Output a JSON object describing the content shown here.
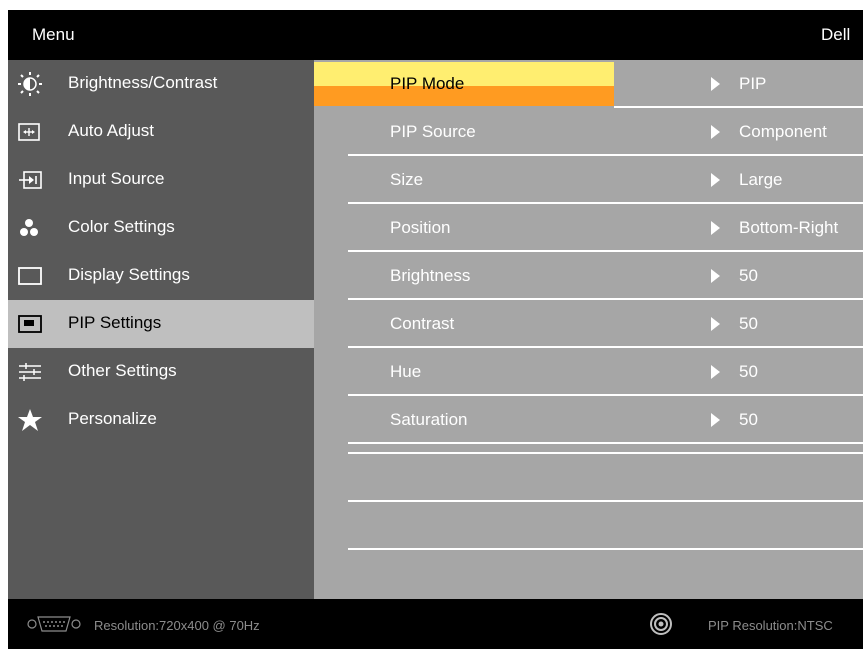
{
  "header": {
    "title": "Menu",
    "brand": "Dell"
  },
  "nav": {
    "items": [
      {
        "label": "Brightness/Contrast",
        "icon": "brightness-icon"
      },
      {
        "label": "Auto Adjust",
        "icon": "auto-adjust-icon"
      },
      {
        "label": "Input Source",
        "icon": "input-source-icon"
      },
      {
        "label": "Color Settings",
        "icon": "color-settings-icon"
      },
      {
        "label": "Display Settings",
        "icon": "display-settings-icon"
      },
      {
        "label": "PIP Settings",
        "icon": "pip-icon"
      },
      {
        "label": "Other Settings",
        "icon": "other-settings-icon"
      },
      {
        "label": "Personalize",
        "icon": "star-icon"
      }
    ],
    "selected": "PIP Settings"
  },
  "settings": {
    "rows": [
      {
        "name": "PIP Mode",
        "value": "PIP"
      },
      {
        "name": "PIP Source",
        "value": "Component"
      },
      {
        "name": "Size",
        "value": "Large"
      },
      {
        "name": "Position",
        "value": "Bottom-Right"
      },
      {
        "name": "Brightness",
        "value": "50"
      },
      {
        "name": "Contrast",
        "value": "50"
      },
      {
        "name": "Hue",
        "value": "50"
      },
      {
        "name": "Saturation",
        "value": "50"
      }
    ],
    "selected": "PIP Mode"
  },
  "footer": {
    "resolution": "Resolution:720x400 @ 70Hz",
    "pip_resolution": "PIP Resolution:NTSC",
    "input_icon": "vga-connector-icon",
    "pip_icon": "pip-source-icon"
  },
  "colors": {
    "panel_dark": "#595959",
    "panel_light": "#a6a6a6",
    "selected_nav": "#bfbfbf",
    "highlight_top": "#ffee70",
    "highlight_bottom": "#ff9b21"
  }
}
